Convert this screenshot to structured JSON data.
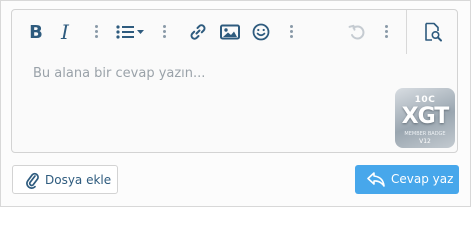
{
  "editor": {
    "toolbar": {
      "bold_label": "B",
      "italic_label": "I",
      "icons": [
        "bold-icon",
        "italic-icon",
        "more-vertical-icon",
        "list-icon",
        "chevron-down-icon",
        "link-icon",
        "image-icon",
        "smiley-icon",
        "undo-icon",
        "preview-icon"
      ]
    },
    "placeholder": "Bu alana bir cevap yazın...",
    "value": ""
  },
  "badge": {
    "top_text": "10C",
    "main_text": "XGT",
    "sub_text": "MEMBER BADGE",
    "version_text": "V12"
  },
  "actions": {
    "attach_label": "Dosya ekle",
    "reply_label": "Cevap yaz"
  },
  "colors": {
    "toolbar_icon": "#2e5b7e",
    "primary_button": "#47a7eb",
    "disabled_icon": "#c5cbd1"
  }
}
